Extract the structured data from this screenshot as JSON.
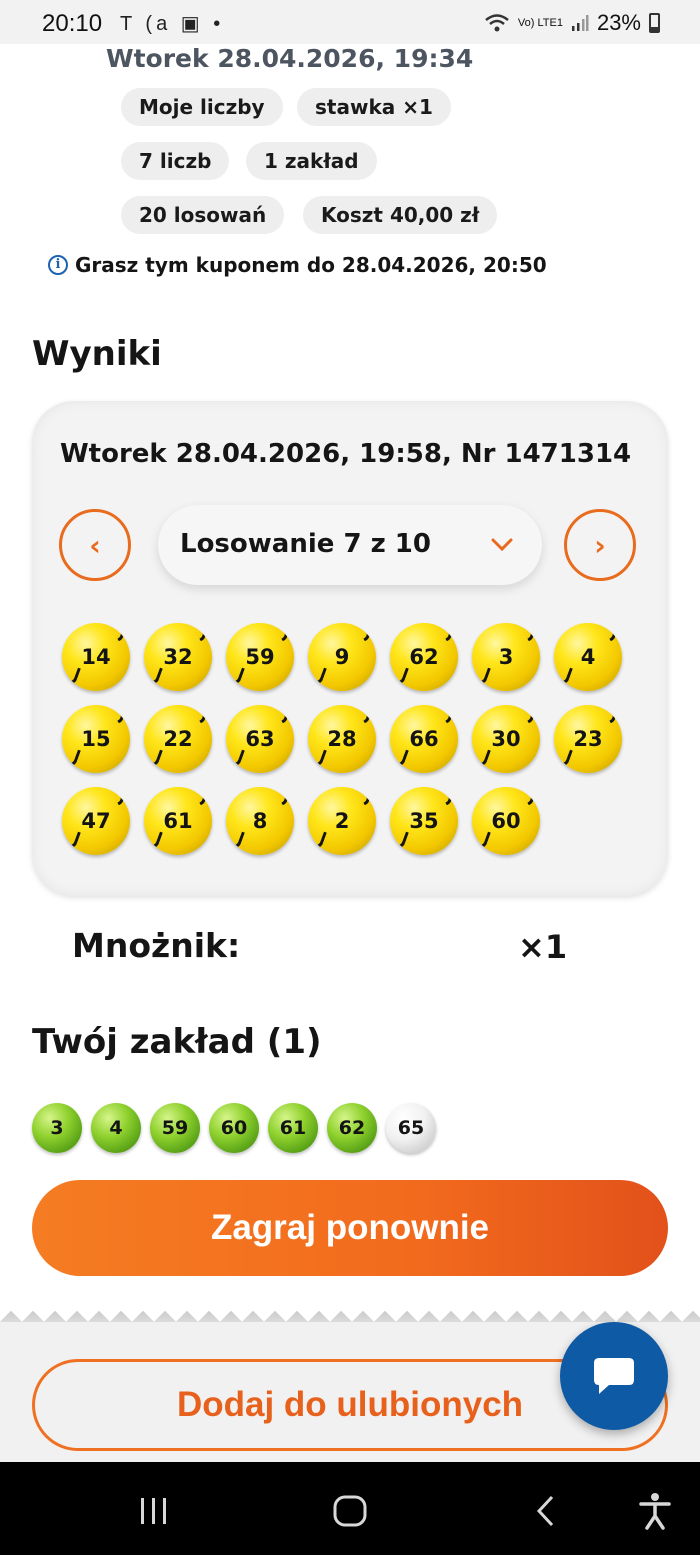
{
  "status_bar": {
    "time": "20:10",
    "left_icons": "T (a ▣ •",
    "network": "Vo) LTE1",
    "battery": "23%"
  },
  "ticket": {
    "date_line": "Wtorek 28.04.2026, 19:34",
    "chips": [
      "Moje liczby",
      "stawka ×1",
      "7 liczb",
      "1 zakład",
      "20 losowań",
      "Koszt 40,00 zł"
    ],
    "validity": "Grasz tym kuponem do 28.04.2026, 20:50"
  },
  "results": {
    "title": "Wyniki",
    "draw_header": "Wtorek 28.04.2026, 19:58, Nr 1471314",
    "draw_selector": "Losowanie 7 z 10",
    "numbers": [
      14,
      32,
      59,
      9,
      62,
      3,
      4,
      15,
      22,
      63,
      28,
      66,
      30,
      23,
      47,
      61,
      8,
      2,
      35,
      60
    ],
    "multiplier_label": "Mnożnik:",
    "multiplier_value": "×1"
  },
  "bet": {
    "title": "Twój zakład (1)",
    "numbers": [
      {
        "n": "3",
        "hit": true
      },
      {
        "n": "4",
        "hit": true
      },
      {
        "n": "59",
        "hit": true
      },
      {
        "n": "60",
        "hit": true
      },
      {
        "n": "61",
        "hit": true
      },
      {
        "n": "62",
        "hit": true
      },
      {
        "n": "65",
        "hit": false
      }
    ]
  },
  "actions": {
    "play_again": "Zagraj ponownie",
    "add_favorite": "Dodaj do ulubionych"
  },
  "colors": {
    "accent": "#f26b1d",
    "accent_outline": "#e86b1e",
    "fab": "#0f5aa4",
    "ball_yellow": "#ffe61a",
    "ball_green": "#8fd12e"
  },
  "nav": {
    "icons": [
      "recent-apps-icon",
      "home-icon",
      "back-icon",
      "accessibility-icon"
    ]
  }
}
